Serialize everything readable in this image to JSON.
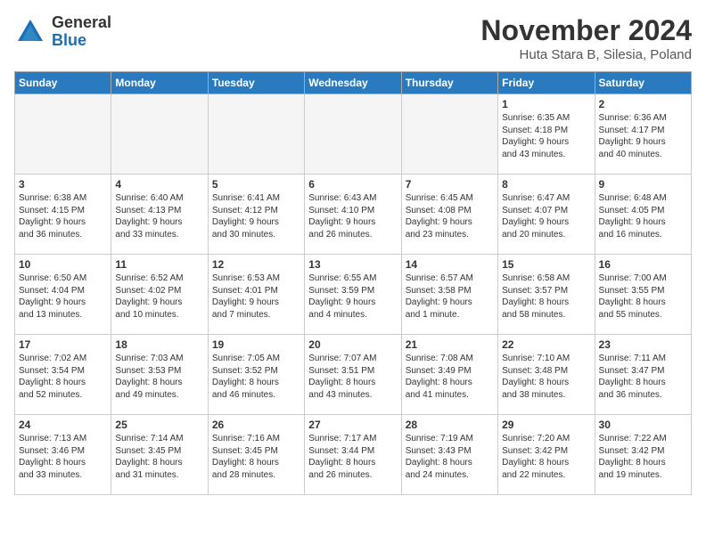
{
  "logo": {
    "general": "General",
    "blue": "Blue"
  },
  "title": "November 2024",
  "location": "Huta Stara B, Silesia, Poland",
  "weekdays": [
    "Sunday",
    "Monday",
    "Tuesday",
    "Wednesday",
    "Thursday",
    "Friday",
    "Saturday"
  ],
  "weeks": [
    [
      {
        "day": "",
        "info": ""
      },
      {
        "day": "",
        "info": ""
      },
      {
        "day": "",
        "info": ""
      },
      {
        "day": "",
        "info": ""
      },
      {
        "day": "",
        "info": ""
      },
      {
        "day": "1",
        "info": "Sunrise: 6:35 AM\nSunset: 4:18 PM\nDaylight: 9 hours\nand 43 minutes."
      },
      {
        "day": "2",
        "info": "Sunrise: 6:36 AM\nSunset: 4:17 PM\nDaylight: 9 hours\nand 40 minutes."
      }
    ],
    [
      {
        "day": "3",
        "info": "Sunrise: 6:38 AM\nSunset: 4:15 PM\nDaylight: 9 hours\nand 36 minutes."
      },
      {
        "day": "4",
        "info": "Sunrise: 6:40 AM\nSunset: 4:13 PM\nDaylight: 9 hours\nand 33 minutes."
      },
      {
        "day": "5",
        "info": "Sunrise: 6:41 AM\nSunset: 4:12 PM\nDaylight: 9 hours\nand 30 minutes."
      },
      {
        "day": "6",
        "info": "Sunrise: 6:43 AM\nSunset: 4:10 PM\nDaylight: 9 hours\nand 26 minutes."
      },
      {
        "day": "7",
        "info": "Sunrise: 6:45 AM\nSunset: 4:08 PM\nDaylight: 9 hours\nand 23 minutes."
      },
      {
        "day": "8",
        "info": "Sunrise: 6:47 AM\nSunset: 4:07 PM\nDaylight: 9 hours\nand 20 minutes."
      },
      {
        "day": "9",
        "info": "Sunrise: 6:48 AM\nSunset: 4:05 PM\nDaylight: 9 hours\nand 16 minutes."
      }
    ],
    [
      {
        "day": "10",
        "info": "Sunrise: 6:50 AM\nSunset: 4:04 PM\nDaylight: 9 hours\nand 13 minutes."
      },
      {
        "day": "11",
        "info": "Sunrise: 6:52 AM\nSunset: 4:02 PM\nDaylight: 9 hours\nand 10 minutes."
      },
      {
        "day": "12",
        "info": "Sunrise: 6:53 AM\nSunset: 4:01 PM\nDaylight: 9 hours\nand 7 minutes."
      },
      {
        "day": "13",
        "info": "Sunrise: 6:55 AM\nSunset: 3:59 PM\nDaylight: 9 hours\nand 4 minutes."
      },
      {
        "day": "14",
        "info": "Sunrise: 6:57 AM\nSunset: 3:58 PM\nDaylight: 9 hours\nand 1 minute."
      },
      {
        "day": "15",
        "info": "Sunrise: 6:58 AM\nSunset: 3:57 PM\nDaylight: 8 hours\nand 58 minutes."
      },
      {
        "day": "16",
        "info": "Sunrise: 7:00 AM\nSunset: 3:55 PM\nDaylight: 8 hours\nand 55 minutes."
      }
    ],
    [
      {
        "day": "17",
        "info": "Sunrise: 7:02 AM\nSunset: 3:54 PM\nDaylight: 8 hours\nand 52 minutes."
      },
      {
        "day": "18",
        "info": "Sunrise: 7:03 AM\nSunset: 3:53 PM\nDaylight: 8 hours\nand 49 minutes."
      },
      {
        "day": "19",
        "info": "Sunrise: 7:05 AM\nSunset: 3:52 PM\nDaylight: 8 hours\nand 46 minutes."
      },
      {
        "day": "20",
        "info": "Sunrise: 7:07 AM\nSunset: 3:51 PM\nDaylight: 8 hours\nand 43 minutes."
      },
      {
        "day": "21",
        "info": "Sunrise: 7:08 AM\nSunset: 3:49 PM\nDaylight: 8 hours\nand 41 minutes."
      },
      {
        "day": "22",
        "info": "Sunrise: 7:10 AM\nSunset: 3:48 PM\nDaylight: 8 hours\nand 38 minutes."
      },
      {
        "day": "23",
        "info": "Sunrise: 7:11 AM\nSunset: 3:47 PM\nDaylight: 8 hours\nand 36 minutes."
      }
    ],
    [
      {
        "day": "24",
        "info": "Sunrise: 7:13 AM\nSunset: 3:46 PM\nDaylight: 8 hours\nand 33 minutes."
      },
      {
        "day": "25",
        "info": "Sunrise: 7:14 AM\nSunset: 3:45 PM\nDaylight: 8 hours\nand 31 minutes."
      },
      {
        "day": "26",
        "info": "Sunrise: 7:16 AM\nSunset: 3:45 PM\nDaylight: 8 hours\nand 28 minutes."
      },
      {
        "day": "27",
        "info": "Sunrise: 7:17 AM\nSunset: 3:44 PM\nDaylight: 8 hours\nand 26 minutes."
      },
      {
        "day": "28",
        "info": "Sunrise: 7:19 AM\nSunset: 3:43 PM\nDaylight: 8 hours\nand 24 minutes."
      },
      {
        "day": "29",
        "info": "Sunrise: 7:20 AM\nSunset: 3:42 PM\nDaylight: 8 hours\nand 22 minutes."
      },
      {
        "day": "30",
        "info": "Sunrise: 7:22 AM\nSunset: 3:42 PM\nDaylight: 8 hours\nand 19 minutes."
      }
    ]
  ]
}
